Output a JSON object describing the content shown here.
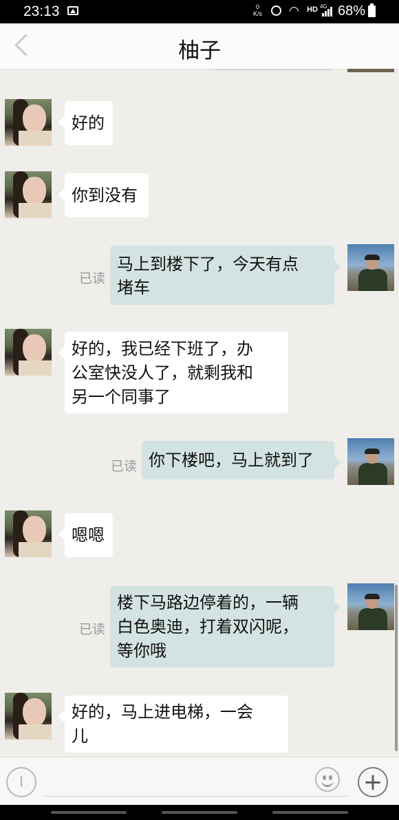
{
  "status_bar": {
    "time": "23:13",
    "net_speed_value": "0",
    "net_speed_unit": "K/s",
    "hd": "HD",
    "network": "4G",
    "battery": "68%"
  },
  "header": {
    "title": "柚子"
  },
  "messages": [
    {
      "side": "left",
      "text": "好的"
    },
    {
      "side": "left",
      "text": "你到没有"
    },
    {
      "side": "right",
      "text": "马上到楼下了，今天有点\n堵车",
      "status": "已读"
    },
    {
      "side": "left",
      "text": "好的，我已经下班了，办\n公室快没人了，就剩我和\n另一个同事了"
    },
    {
      "side": "right",
      "text": "你下楼吧，马上就到了",
      "status": "已读"
    },
    {
      "side": "left",
      "text": "嗯嗯"
    },
    {
      "side": "right",
      "text": "楼下马路边停着的，一辆\n白色奥迪，打着双闪呢，\n等你哦",
      "status": "已读"
    },
    {
      "side": "left",
      "text": "好的，马上进电梯，一会\n儿"
    }
  ],
  "input_bar": {
    "plus_symbol": "+"
  },
  "colors": {
    "background": "#efeeea",
    "bubble_left": "#ffffff",
    "bubble_right": "#d3e3e1",
    "read_text": "#9a9a9a"
  }
}
